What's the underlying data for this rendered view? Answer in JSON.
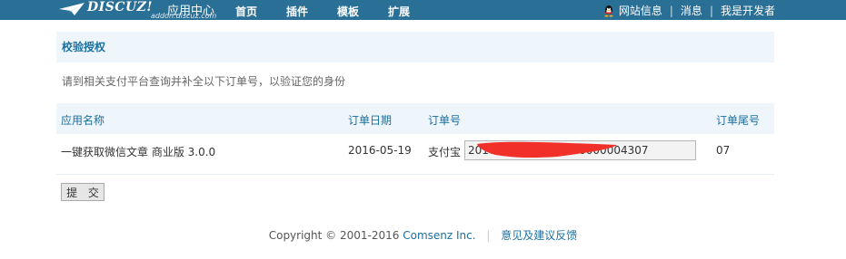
{
  "brand": {
    "logo_text": "DISCUZ!",
    "subtitle": "应用中心",
    "url": "addon.discuz.com",
    "color": "#2a6f95"
  },
  "nav": {
    "items": [
      "首页",
      "插件",
      "模板",
      "扩展"
    ]
  },
  "toplinks": {
    "site_info": "网站信息",
    "messages": "消息",
    "developer": "我是开发者",
    "separator": "|"
  },
  "section": {
    "title": "校验授权",
    "description": "请到相关支付平台查询并补全以下订单号，以验证您的身份"
  },
  "table": {
    "headers": {
      "app_name": "应用名称",
      "order_date": "订单日期",
      "order_no": "订单号",
      "order_tail": "订单尾号"
    },
    "row": {
      "app_name": "一键获取微信文章 商业版 3.0.0",
      "order_date": "2016-05-19",
      "payment": "支付宝",
      "order_value": "20160519216060000000004307",
      "order_tail": "07"
    }
  },
  "submit_label": "提 交",
  "footer": {
    "copyright": "Copyright © 2001-2016",
    "company": "Comsenz Inc.",
    "separator": "|",
    "feedback": "意见及建议反馈"
  }
}
